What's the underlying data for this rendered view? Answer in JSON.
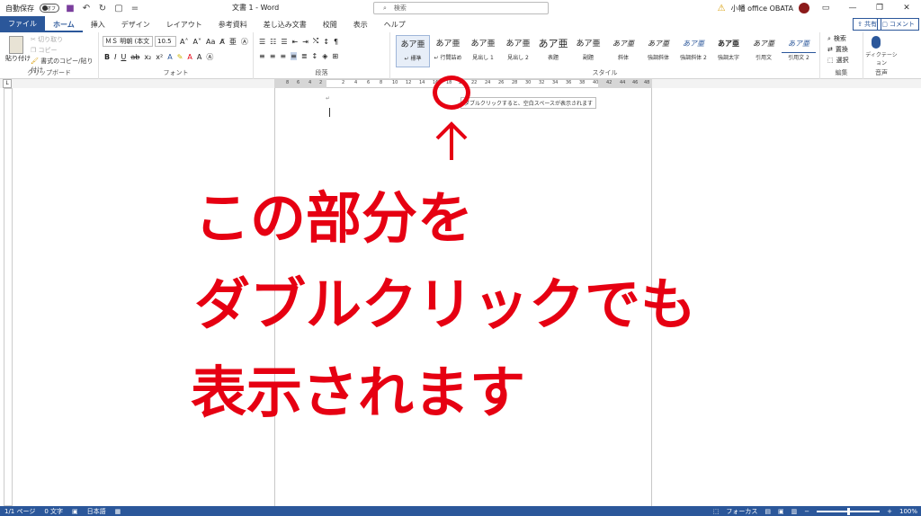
{
  "titlebar": {
    "autosave_label": "自動保存",
    "autosave_state": "オフ",
    "doc_title": "文書 1 - Word",
    "search_placeholder": "検索",
    "user_name": "小幡 office OBATA"
  },
  "tabs": [
    "ファイル",
    "ホーム",
    "挿入",
    "デザイン",
    "レイアウト",
    "参考資料",
    "差し込み文書",
    "校閲",
    "表示",
    "ヘルプ"
  ],
  "share_label": "共有",
  "comment_label": "コメント",
  "clipboard": {
    "paste_label": "貼り付け",
    "cut_label": "切り取り",
    "copy_label": "コピー",
    "format_painter_label": "書式のコピー/貼り付け",
    "group_label": "クリップボード"
  },
  "font": {
    "font_name": "ＭＳ 明朝 (本文",
    "font_size": "10.5",
    "group_label": "フォント"
  },
  "paragraph": {
    "group_label": "段落"
  },
  "styles": {
    "group_label": "スタイル",
    "items": [
      {
        "sample": "あア亜",
        "name": "↵ 標準"
      },
      {
        "sample": "あア亜",
        "name": "↵ 行間詰め"
      },
      {
        "sample": "あア亜",
        "name": "見出し 1"
      },
      {
        "sample": "あア亜",
        "name": "見出し 2"
      },
      {
        "sample": "あア亜",
        "name": "表題"
      },
      {
        "sample": "あア亜",
        "name": "副題"
      },
      {
        "sample": "あア亜",
        "name": "斜体"
      },
      {
        "sample": "あア亜",
        "name": "強調斜体"
      },
      {
        "sample": "あア亜",
        "name": "強調斜体 2"
      },
      {
        "sample": "あア亜",
        "name": "強調太字"
      },
      {
        "sample": "あア亜",
        "name": "引用文"
      },
      {
        "sample": "あア亜",
        "name": "引用文 2"
      }
    ]
  },
  "editing": {
    "find_label": "検索",
    "replace_label": "置換",
    "select_label": "選択",
    "group_label": "編集"
  },
  "voice": {
    "dictate_label": "ディクテーション",
    "group_label": "音声"
  },
  "ruler": {
    "numbers_left": [
      "8",
      "6",
      "4",
      "2"
    ],
    "numbers_main": [
      "2",
      "4",
      "6",
      "8",
      "10",
      "12",
      "14",
      "16",
      "18",
      "20",
      "22",
      "24",
      "26",
      "28",
      "30",
      "32",
      "34",
      "36",
      "38",
      "40",
      "42",
      "44",
      "46",
      "48"
    ]
  },
  "tooltip_text": "ダブルクリックすると、空白スペースが表示されます",
  "annotation": {
    "line1": "この部分を",
    "line2": "ダブルクリックでも",
    "line3": "表示されます",
    "color": "#e60012"
  },
  "status": {
    "page": "1/1 ページ",
    "words": "0 文字",
    "language": "日本語",
    "focus": "フォーカス",
    "zoom": "100%"
  }
}
